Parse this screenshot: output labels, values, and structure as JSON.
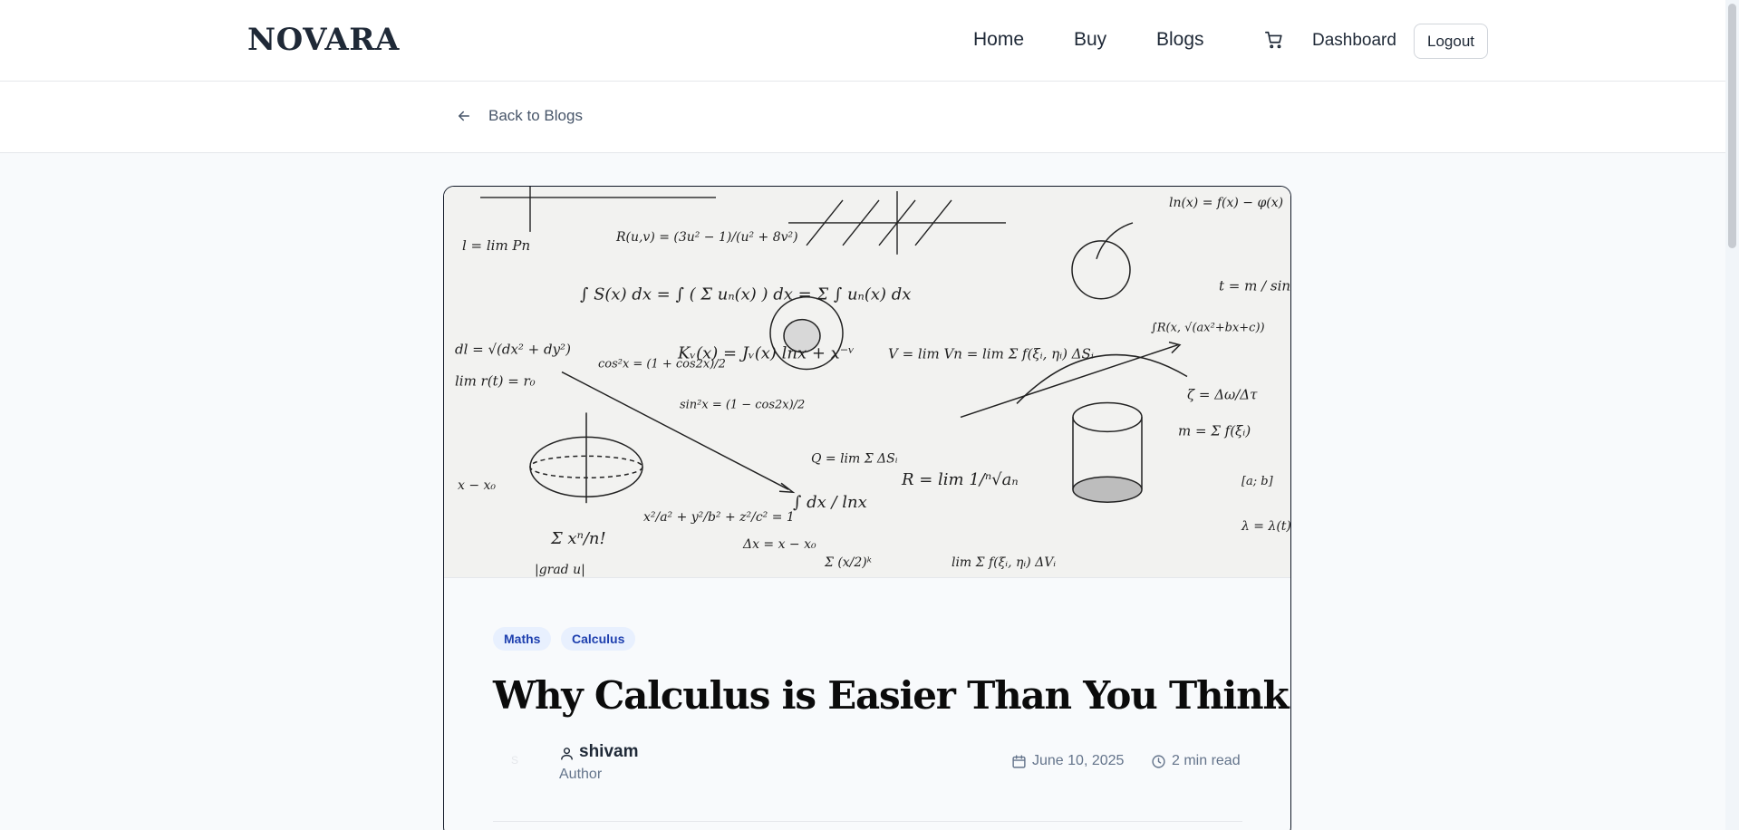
{
  "brand": "NOVARA",
  "nav": {
    "home": "Home",
    "buy": "Buy",
    "blogs": "Blogs",
    "cart_icon": "cart-icon",
    "dashboard": "Dashboard",
    "logout": "Logout"
  },
  "back_link": {
    "label": "Back to Blogs",
    "icon": "arrow-left-icon"
  },
  "post": {
    "tags": [
      "Maths",
      "Calculus"
    ],
    "title": "Why Calculus is Easier Than You Think",
    "title_emoji": "brain-icon",
    "avatar_letter": "S",
    "author": {
      "name": "shivam",
      "role": "Author"
    },
    "date": "June 10, 2025",
    "read_time": "2 min read",
    "hero_image": "calculus formulas chalk sketch",
    "hero_formulas": [
      "∫ S(x) dx = ∫ ( Σ uₙ(x) ) dx = Σ ∫ uₙ(x) dx",
      "Kᵥ(x) = Jᵥ(x) lnx + x⁻ᵛ",
      "V = lim Vn = lim Σ f(ξᵢ, ηᵢ) ΔSᵢ",
      "R = lim 1/ⁿ√aₙ",
      "∫ dx / lnx",
      "x²/a² + y²/b² + z²/c² = 1",
      "Σ xⁿ/n!",
      "Δx = x − x₀",
      "lim r(t) = r₀",
      "dl = √(dx² + dy²)",
      "cos²x = (1 + cos2x)/2",
      "sin²x = (1 − cos2x)/2",
      "t = m / sinz",
      "ln(x) = f(x) − φ(x)",
      "R(u,v) = (3u² − 1)/(u² + 8v²)",
      "m = Σ f(ξᵢ)",
      "Σ (x/2)ᵏ",
      "∫R(x, √(ax²+bx+c))",
      "ζ = Δω/Δτ",
      "Q = lim Σ ΔSᵢ",
      "|grad u|"
    ]
  },
  "colors": {
    "accent_tag_bg": "#e8f0fe",
    "accent_tag_text": "#1e40af",
    "text_dark": "#1f2937",
    "muted": "#64748b"
  }
}
